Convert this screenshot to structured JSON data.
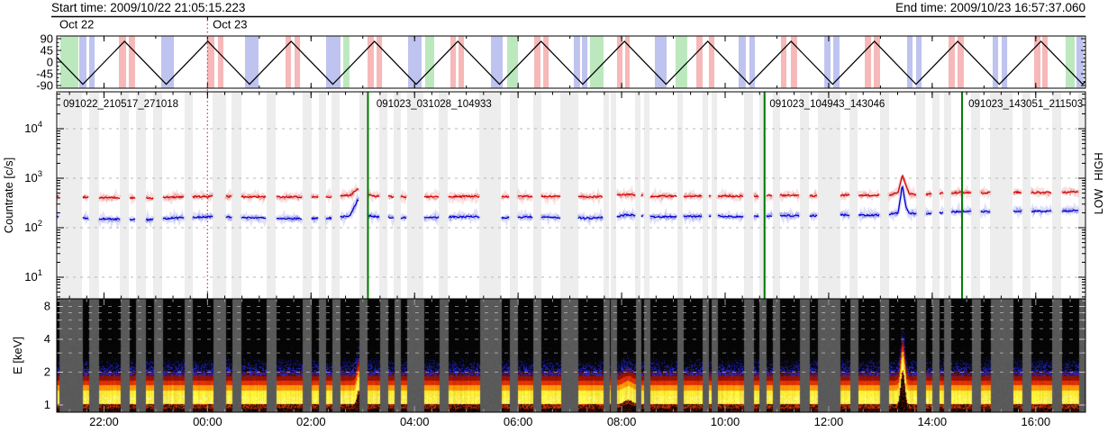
{
  "header": {
    "start_label": "Start time: 2009/10/22 21:05:15.223",
    "end_label": "End time: 2009/10/23 16:57:37.060",
    "date_labels": [
      {
        "text": "Oct 22",
        "frac": 0.0018
      },
      {
        "text": "Oct 23",
        "frac": 0.149
      }
    ]
  },
  "colors": {
    "low_curve_red": "#cc0000",
    "high_curve_blue": "#0000cc",
    "file_boundary_green": "#007a00",
    "day_boundary_red": "#e04040",
    "band_red": "#f6b8b8",
    "band_blue": "#bfc3ef",
    "band_green": "#bce8bd",
    "gap_gray": "#ededed",
    "spectrogram_gap_gray": "#5a5a5a",
    "file_label_gray": "#909090"
  },
  "chart_data": {
    "type": [
      "line",
      "line",
      "heatmap"
    ],
    "time_axis": {
      "start": "2009/10/22 21:05:15.223",
      "end": "2009/10/23 16:57:37.060",
      "total_hours": 19.8728,
      "major_tick_labels": [
        "22:00",
        "00:00",
        "02:00",
        "04:00",
        "06:00",
        "08:00",
        "10:00",
        "12:00",
        "14:00",
        "16:00"
      ],
      "major_tick_hours_from_start": [
        0.9124,
        2.9124,
        4.9124,
        6.9124,
        8.9124,
        10.9124,
        12.9124,
        14.9124,
        16.9124,
        18.9124
      ],
      "minor_tick_step_hours": 0.3333,
      "first_minor_tick_hour": 0.2458,
      "day_boundary_hour": 2.9124
    },
    "pointing": {
      "yticks": [
        90,
        45,
        0,
        -45,
        -90
      ],
      "ylim": [
        -100,
        100
      ],
      "wave": {
        "shape": "triangle",
        "period_hours": 1.6095,
        "first_min_hour_from_start": 0.5047,
        "max_deg": 80,
        "min_deg": -85
      },
      "bands": [
        [
          0.0035,
          0.0175,
          "g"
        ],
        [
          0.0219,
          0.007,
          "b"
        ],
        [
          0.0315,
          0.0053,
          "b"
        ],
        [
          0.0604,
          0.007,
          "r"
        ],
        [
          0.07,
          0.0061,
          "r"
        ],
        [
          0.1016,
          0.0123,
          "b"
        ],
        [
          0.1462,
          0.007,
          "r"
        ],
        [
          0.1567,
          0.0053,
          "r"
        ],
        [
          0.183,
          0.0131,
          "b"
        ],
        [
          0.2224,
          0.0053,
          "r"
        ],
        [
          0.2312,
          0.0053,
          "r"
        ],
        [
          0.2618,
          0.014,
          "b"
        ],
        [
          0.2784,
          0.0061,
          "g"
        ],
        [
          0.3021,
          0.0061,
          "r"
        ],
        [
          0.3109,
          0.0053,
          "r"
        ],
        [
          0.3415,
          0.0131,
          "b"
        ],
        [
          0.3581,
          0.0088,
          "g"
        ],
        [
          0.3827,
          0.0053,
          "r"
        ],
        [
          0.3905,
          0.0053,
          "r"
        ],
        [
          0.4221,
          0.0114,
          "b"
        ],
        [
          0.4378,
          0.0105,
          "g"
        ],
        [
          0.4641,
          0.0061,
          "r"
        ],
        [
          0.4729,
          0.0053,
          "r"
        ],
        [
          0.5026,
          0.0061,
          "b"
        ],
        [
          0.5105,
          0.0053,
          "b"
        ],
        [
          0.5184,
          0.0131,
          "g"
        ],
        [
          0.5446,
          0.0053,
          "r"
        ],
        [
          0.5525,
          0.0044,
          "r"
        ],
        [
          0.5814,
          0.0114,
          "b"
        ],
        [
          0.6015,
          0.0114,
          "g"
        ],
        [
          0.6217,
          0.0061,
          "r"
        ],
        [
          0.6339,
          0.0053,
          "r"
        ],
        [
          0.6628,
          0.007,
          "b"
        ],
        [
          0.6733,
          0.0053,
          "b"
        ],
        [
          0.704,
          0.0053,
          "r"
        ],
        [
          0.7136,
          0.0061,
          "r"
        ],
        [
          0.7461,
          0.0061,
          "b"
        ],
        [
          0.7548,
          0.0061,
          "b"
        ],
        [
          0.7855,
          0.0061,
          "r"
        ],
        [
          0.7942,
          0.0061,
          "r"
        ],
        [
          0.8266,
          0.0053,
          "b"
        ],
        [
          0.8354,
          0.0053,
          "b"
        ],
        [
          0.8669,
          0.0061,
          "r"
        ],
        [
          0.8756,
          0.0061,
          "r"
        ],
        [
          0.9098,
          0.0053,
          "b"
        ],
        [
          0.9186,
          0.0053,
          "b"
        ],
        [
          0.9501,
          0.0061,
          "r"
        ],
        [
          0.958,
          0.0053,
          "r"
        ],
        [
          0.9807,
          0.0088,
          "g"
        ],
        [
          0.9912,
          0.007,
          "b"
        ]
      ]
    },
    "countrate": {
      "ylabel": "Countrate [c/s]",
      "yticks": [
        10,
        100,
        1000,
        10000
      ],
      "ylim_log10": [
        0.564,
        4.745
      ],
      "right_labels": {
        "high": "HIGH",
        "low": "LOW"
      },
      "files": [
        {
          "label": "091022_210517_271018",
          "f": 0.0045
        },
        {
          "label": "091023_031028_104933",
          "f": 0.309
        },
        {
          "label": "091023_104943_143046",
          "f": 0.6912
        },
        {
          "label": "091023_143051_211503",
          "f": 0.8845
        }
      ],
      "file_boundaries_f": [
        0.3025,
        0.688,
        0.88
      ],
      "gaps": [
        [
          0.0018,
          0.0228
        ],
        [
          0.0315,
          0.0096
        ],
        [
          0.0613,
          0.0088
        ],
        [
          0.077,
          0.0096
        ],
        [
          0.0937,
          0.0088
        ],
        [
          0.1243,
          0.0079
        ],
        [
          0.1515,
          0.0131
        ],
        [
          0.1699,
          0.0096
        ],
        [
          0.204,
          0.0088
        ],
        [
          0.239,
          0.0088
        ],
        [
          0.2548,
          0.007
        ],
        [
          0.2671,
          0.0079
        ],
        [
          0.2942,
          0.0079
        ],
        [
          0.3135,
          0.0079
        ],
        [
          0.3275,
          0.007
        ],
        [
          0.3406,
          0.0158
        ],
        [
          0.3713,
          0.0088
        ],
        [
          0.4107,
          0.021
        ],
        [
          0.4404,
          0.0079
        ],
        [
          0.4632,
          0.0079
        ],
        [
          0.4895,
          0.0175
        ],
        [
          0.5315,
          0.0053
        ],
        [
          0.5385,
          0.0053
        ],
        [
          0.5622,
          0.0053
        ],
        [
          0.5709,
          0.0053
        ],
        [
          0.6033,
          0.0053
        ],
        [
          0.6278,
          0.0053
        ],
        [
          0.6366,
          0.0053
        ],
        [
          0.6681,
          0.0088
        ],
        [
          0.683,
          0.007
        ],
        [
          0.6961,
          0.007
        ],
        [
          0.7224,
          0.0088
        ],
        [
          0.7399,
          0.0219
        ],
        [
          0.7706,
          0.0079
        ],
        [
          0.8003,
          0.0088
        ],
        [
          0.8354,
          0.0088
        ],
        [
          0.8511,
          0.007
        ],
        [
          0.8625,
          0.007
        ],
        [
          0.8888,
          0.0088
        ],
        [
          0.9072,
          0.0219
        ],
        [
          0.9387,
          0.0079
        ],
        [
          0.9676,
          0.0088
        ],
        [
          0.993,
          0.007
        ]
      ],
      "series": [
        {
          "name": "LOW",
          "color": "#cc0000",
          "keypoints": [
            [
              0.0,
              430
            ],
            [
              0.03,
              415
            ],
            [
              0.06,
              400
            ],
            [
              0.09,
              395
            ],
            [
              0.12,
              420
            ],
            [
              0.16,
              430
            ],
            [
              0.19,
              420
            ],
            [
              0.22,
              415
            ],
            [
              0.25,
              420
            ],
            [
              0.27,
              425
            ],
            [
              0.285,
              450
            ],
            [
              0.293,
              620
            ],
            [
              0.298,
              470
            ],
            [
              0.31,
              430
            ],
            [
              0.34,
              420
            ],
            [
              0.37,
              425
            ],
            [
              0.4,
              430
            ],
            [
              0.43,
              420
            ],
            [
              0.46,
              430
            ],
            [
              0.49,
              425
            ],
            [
              0.52,
              420
            ],
            [
              0.545,
              450
            ],
            [
              0.555,
              470
            ],
            [
              0.565,
              445
            ],
            [
              0.58,
              430
            ],
            [
              0.61,
              435
            ],
            [
              0.64,
              440
            ],
            [
              0.67,
              430
            ],
            [
              0.7,
              450
            ],
            [
              0.73,
              440
            ],
            [
              0.76,
              455
            ],
            [
              0.79,
              450
            ],
            [
              0.81,
              460
            ],
            [
              0.818,
              520
            ],
            [
              0.822,
              1150
            ],
            [
              0.8255,
              700
            ],
            [
              0.829,
              480
            ],
            [
              0.84,
              470
            ],
            [
              0.86,
              490
            ],
            [
              0.88,
              520
            ],
            [
              0.9,
              510
            ],
            [
              0.92,
              515
            ],
            [
              0.94,
              520
            ],
            [
              0.96,
              510
            ],
            [
              0.98,
              520
            ],
            [
              1.0,
              530
            ]
          ]
        },
        {
          "name": "HIGH",
          "color": "#0000cc",
          "keypoints": [
            [
              0.0,
              170
            ],
            [
              0.03,
              155
            ],
            [
              0.06,
              148
            ],
            [
              0.09,
              145
            ],
            [
              0.12,
              160
            ],
            [
              0.16,
              168
            ],
            [
              0.19,
              158
            ],
            [
              0.22,
              152
            ],
            [
              0.25,
              155
            ],
            [
              0.27,
              158
            ],
            [
              0.285,
              175
            ],
            [
              0.293,
              380
            ],
            [
              0.298,
              185
            ],
            [
              0.31,
              165
            ],
            [
              0.34,
              158
            ],
            [
              0.37,
              162
            ],
            [
              0.4,
              168
            ],
            [
              0.43,
              160
            ],
            [
              0.46,
              165
            ],
            [
              0.49,
              160
            ],
            [
              0.52,
              155
            ],
            [
              0.545,
              170
            ],
            [
              0.555,
              185
            ],
            [
              0.565,
              172
            ],
            [
              0.58,
              165
            ],
            [
              0.61,
              168
            ],
            [
              0.64,
              172
            ],
            [
              0.67,
              165
            ],
            [
              0.7,
              178
            ],
            [
              0.73,
              172
            ],
            [
              0.76,
              182
            ],
            [
              0.79,
              178
            ],
            [
              0.81,
              185
            ],
            [
              0.818,
              200
            ],
            [
              0.822,
              750
            ],
            [
              0.8255,
              260
            ],
            [
              0.829,
              195
            ],
            [
              0.84,
              190
            ],
            [
              0.86,
              200
            ],
            [
              0.88,
              215
            ],
            [
              0.9,
              210
            ],
            [
              0.92,
              215
            ],
            [
              0.94,
              218
            ],
            [
              0.96,
              212
            ],
            [
              0.98,
              218
            ],
            [
              1.0,
              222
            ]
          ]
        }
      ]
    },
    "spectrogram": {
      "ylabel": "E [keV]",
      "yticks": [
        1,
        2,
        4,
        8
      ],
      "ylim_kev": [
        0.86,
        9.4
      ],
      "gridline_energies": [
        2,
        3,
        4,
        5,
        6,
        7,
        8
      ],
      "enhancements": [
        {
          "f": 0.293,
          "sigma": 0.0022,
          "factor": 1.35
        },
        {
          "f": 0.555,
          "sigma": 0.006,
          "factor": 1.1
        },
        {
          "f": 0.822,
          "sigma": 0.0025,
          "factor": 2.05
        }
      ]
    }
  }
}
